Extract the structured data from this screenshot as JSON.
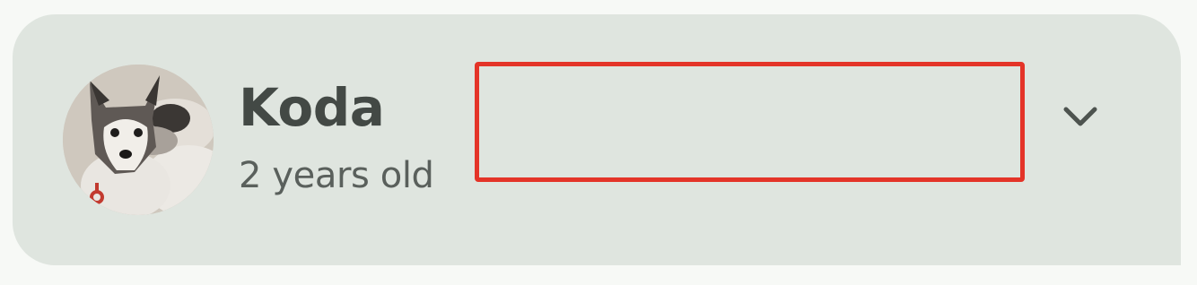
{
  "pet": {
    "name": "Koda",
    "age": "2 years old",
    "avatar_icon": "dog-photo-avatar"
  },
  "controls": {
    "expand_icon": "chevron-down-icon"
  },
  "colors": {
    "card_background": "#dfe5df",
    "page_background": "#f7f9f6",
    "name_text": "#434945",
    "age_text": "#5a605c",
    "highlight_border": "#e43428",
    "chevron": "#4d534f"
  }
}
